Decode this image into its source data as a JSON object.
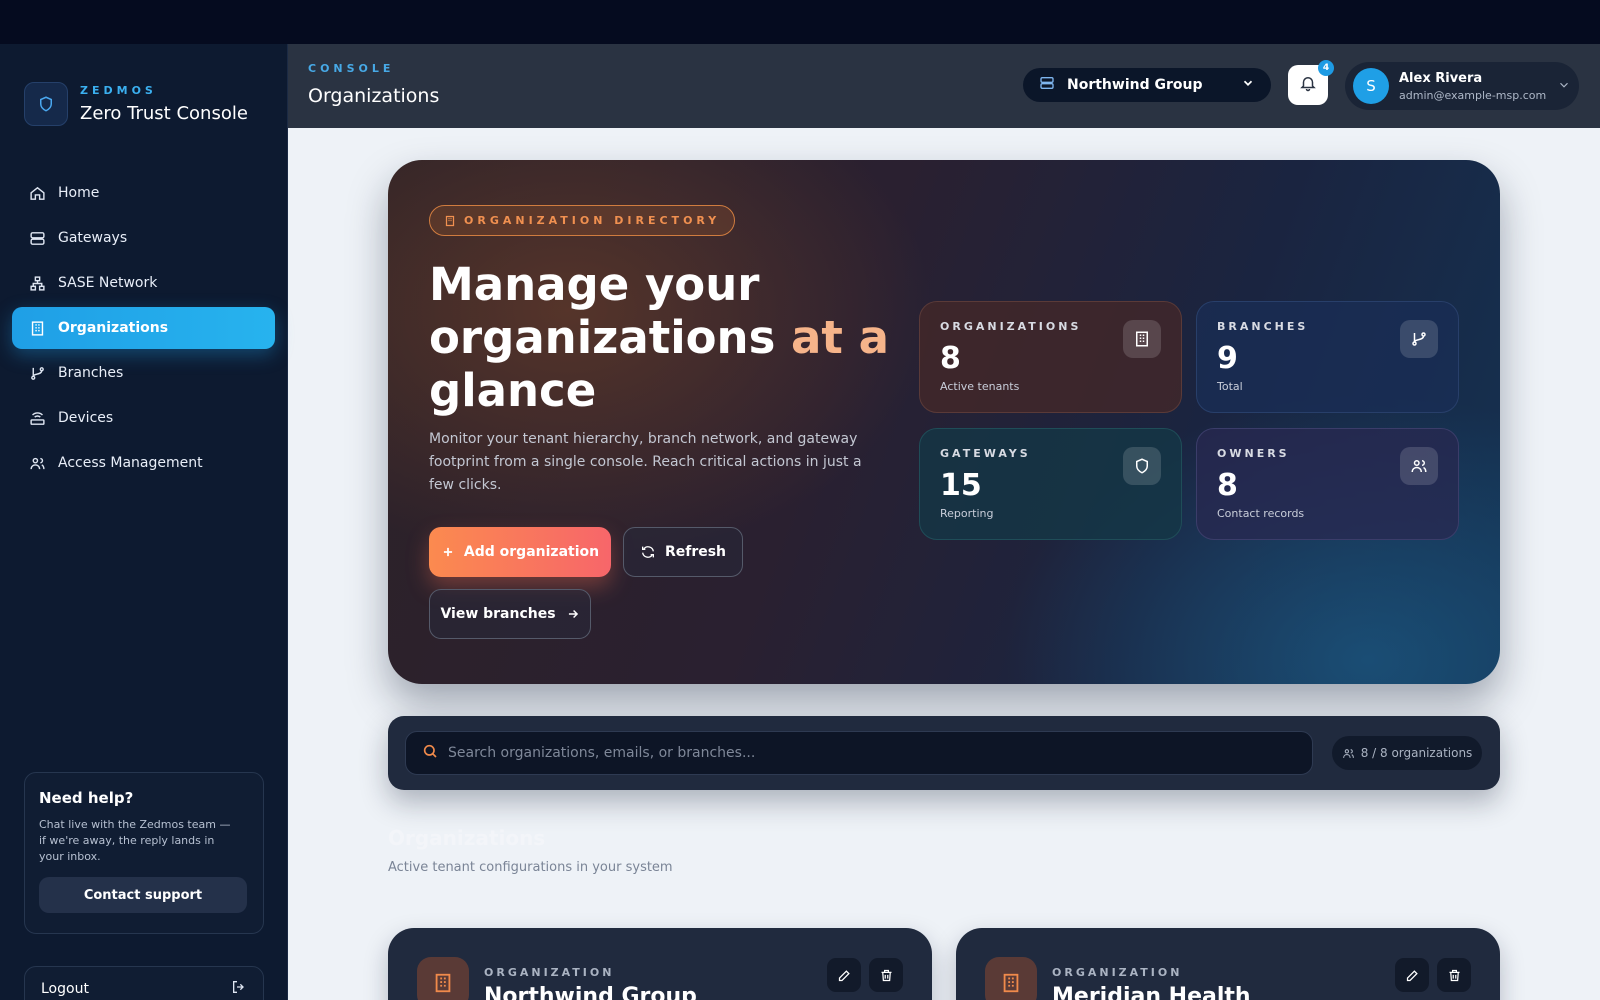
{
  "brand": {
    "eyebrow": "ZEDMOS",
    "title": "Zero Trust Console"
  },
  "sidebar": {
    "items": [
      {
        "label": "Home",
        "icon": "home-icon"
      },
      {
        "label": "Gateways",
        "icon": "server-icon"
      },
      {
        "label": "SASE Network",
        "icon": "network-icon"
      },
      {
        "label": "Organizations",
        "icon": "building-icon",
        "active": true
      },
      {
        "label": "Branches",
        "icon": "git-branch-icon"
      },
      {
        "label": "Devices",
        "icon": "router-icon"
      },
      {
        "label": "Access Management",
        "icon": "users-icon"
      }
    ],
    "help": {
      "title": "Need help?",
      "text": "Chat live with the Zedmos team — if we're away, the reply lands in your inbox.",
      "button": "Contact support"
    },
    "logout": "Logout"
  },
  "header": {
    "eyebrow": "CONSOLE",
    "title": "Organizations",
    "org_select": "Northwind Group",
    "notifications": "4",
    "user": {
      "initial": "S",
      "name": "Alex Rivera",
      "email": "admin@example-msp.com"
    }
  },
  "hero": {
    "pill": "ORGANIZATION DIRECTORY",
    "title_part1": "Manage your organizations ",
    "title_accent": "at a",
    "title_part2": " glance",
    "description": "Monitor your tenant hierarchy, branch network, and gateway footprint from a single console. Reach critical actions in just a few clicks.",
    "add_button": "Add organization",
    "refresh_button": "Refresh",
    "view_branches_button": "View branches",
    "stats": {
      "organizations": {
        "label": "ORGANIZATIONS",
        "value": "8",
        "sub": "Active tenants"
      },
      "branches": {
        "label": "BRANCHES",
        "value": "9",
        "sub": "Total"
      },
      "gateways": {
        "label": "GATEWAYS",
        "value": "15",
        "sub": "Reporting"
      },
      "owners": {
        "label": "OWNERS",
        "value": "8",
        "sub": "Contact records"
      }
    }
  },
  "search": {
    "placeholder": "Search organizations, emails, or branches...",
    "count": "8 / 8 organizations"
  },
  "section": {
    "title": "Organizations",
    "subtitle": "Active tenant configurations in your system"
  },
  "cards": [
    {
      "eyebrow": "ORGANIZATION",
      "name": "Northwind Group"
    },
    {
      "eyebrow": "ORGANIZATION",
      "name": "Meridian Health"
    }
  ],
  "colors": {
    "accent": "#1f9fe6",
    "brand_orange": "#fb8a4f",
    "sidebar_bg": "#0d1a30"
  }
}
